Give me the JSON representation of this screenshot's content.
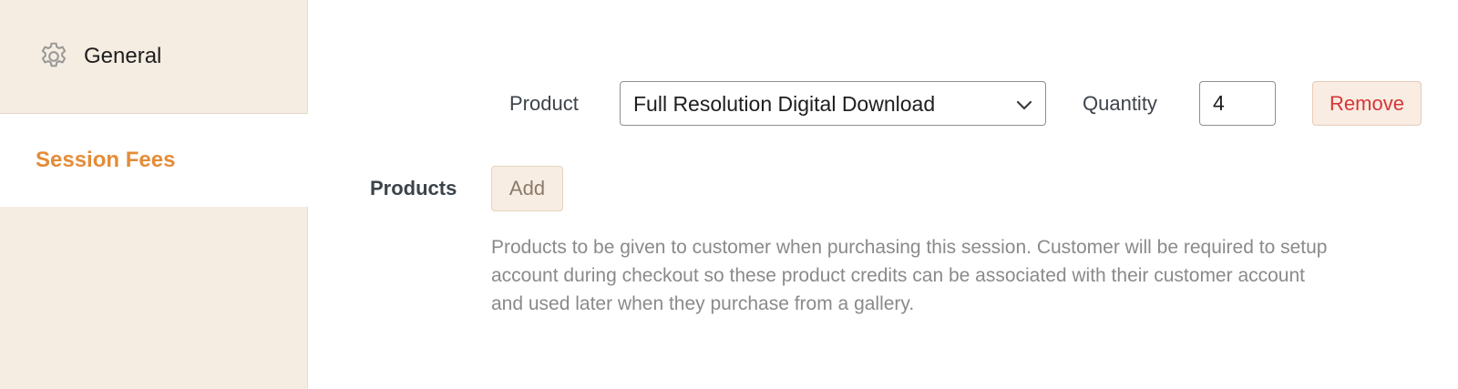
{
  "sidebar": {
    "items": [
      {
        "label": "General",
        "icon": "gear-icon",
        "active": false
      },
      {
        "label": "Session Fees",
        "active": true
      }
    ]
  },
  "product_row": {
    "product_label": "Product",
    "product_value": "Full Resolution Digital Download",
    "quantity_label": "Quantity",
    "quantity_value": "4",
    "remove_label": "Remove"
  },
  "products_field": {
    "label": "Products",
    "add_label": "Add",
    "description_lines": [
      "Products to be given to customer when purchasing this session. Customer will be required to setup",
      "account during checkout so these product credits can be associated with their customer account",
      "and used later when they purchase from a gallery."
    ]
  },
  "colors": {
    "sidebar_bg": "#f6ede2",
    "accent": "#e48c37",
    "remove_text": "#d63638",
    "muted_text": "#8a8a8a"
  }
}
